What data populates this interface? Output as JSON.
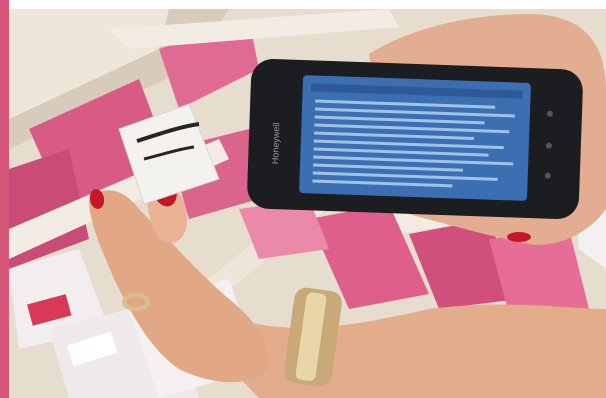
{
  "colors": {
    "accent_bar": "#d7577a",
    "page_background": "#ffffff",
    "shelf_wood": "#e7ddcf",
    "package_pink": "#d85b86",
    "package_white": "#f2eef0",
    "phone_body": "#1c1d20",
    "phone_screen": "#3c6fb2",
    "skin": "#e3ad8c",
    "nail_polish": "#c4172a",
    "bracelet_gold": "#c9a977"
  },
  "photo": {
    "subject": "hand-holding-phone-scanning-package",
    "phone_brand_text": "Honeywell"
  }
}
